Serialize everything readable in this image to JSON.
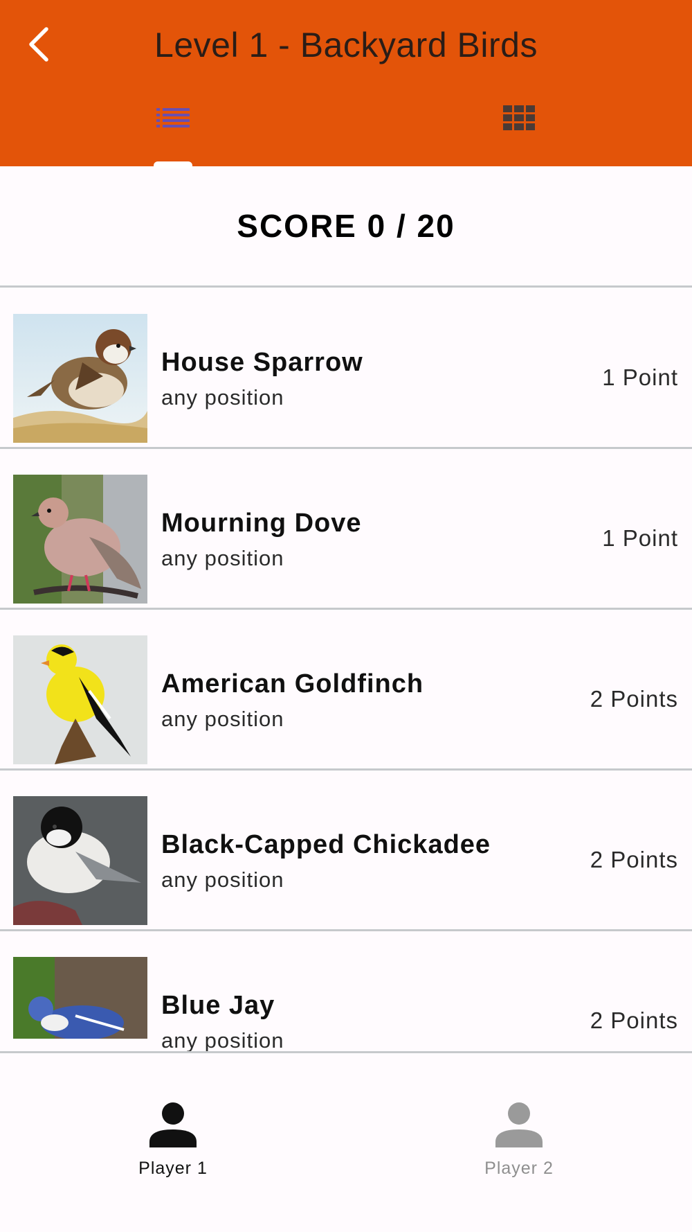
{
  "header": {
    "title": "Level 1 - Backyard Birds",
    "back_icon": "back-arrow-icon",
    "tabs": [
      {
        "icon": "list-view-icon",
        "selected": true
      },
      {
        "icon": "grid-view-icon",
        "selected": false
      }
    ]
  },
  "score": {
    "text": "SCORE 0 / 20"
  },
  "birds": [
    {
      "name": "House Sparrow",
      "position": "any position",
      "points": "1 Point"
    },
    {
      "name": "Mourning Dove",
      "position": "any position",
      "points": "1 Point"
    },
    {
      "name": "American Goldfinch",
      "position": "any position",
      "points": "2 Points"
    },
    {
      "name": "Black-Capped Chickadee",
      "position": "any position",
      "points": "2 Points"
    },
    {
      "name": "Blue Jay",
      "position": "any position",
      "points": "2 Points"
    }
  ],
  "bottom_nav": {
    "items": [
      {
        "label": "Player 1",
        "icon": "person-icon",
        "selected": true
      },
      {
        "label": "Player 2",
        "icon": "person-icon",
        "selected": false
      }
    ]
  },
  "colors": {
    "appbar": "#e35409",
    "tab_selected_icon": "#6a4fb0",
    "tab_unselected_icon": "#4a3a35",
    "nav_selected": "#111111",
    "nav_unselected": "#9a9a9a"
  }
}
